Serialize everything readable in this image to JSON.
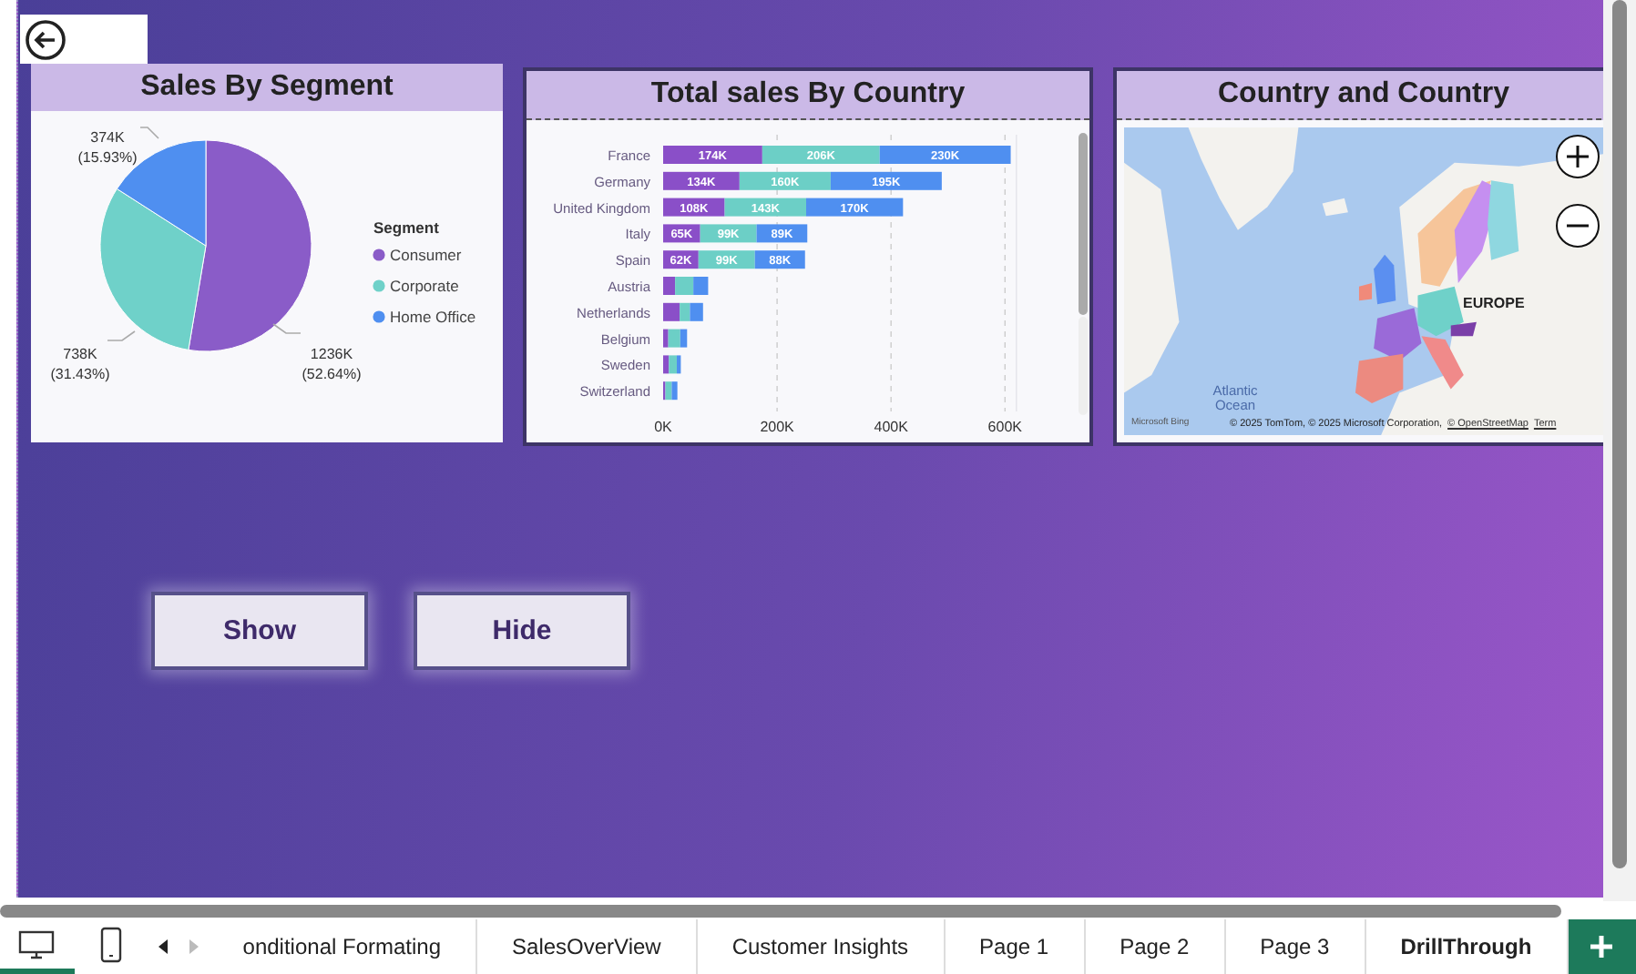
{
  "segment_card": {
    "title": "Sales By Segment",
    "chart_data": {
      "type": "pie",
      "legend": {
        "title": "Segment"
      },
      "categories": [
        "Consumer",
        "Corporate",
        "Home Office"
      ],
      "values": [
        52.64,
        31.43,
        15.93
      ],
      "colors": [
        "#8a5cc8",
        "#6fd1c9",
        "#4f8ff0"
      ],
      "value_labels": [
        "1236K (52.64%)",
        "738K (31.43%)",
        "374K (15.93%)"
      ]
    }
  },
  "country_card": {
    "title": "Total sales By Country",
    "chart_data": {
      "type": "bar",
      "orientation": "horizontal",
      "stacked": true,
      "categories": [
        "France",
        "Germany",
        "United Kingdom",
        "Italy",
        "Spain",
        "Austria",
        "Netherlands",
        "Belgium",
        "Sweden",
        "Switzerland"
      ],
      "series": [
        {
          "color": "#8a4fc8",
          "values": [
            174,
            134,
            108,
            65,
            62,
            21,
            29,
            9,
            10,
            4
          ],
          "value_labels": [
            "174K",
            "134K",
            "108K",
            "65K",
            "62K",
            null,
            null,
            null,
            null,
            null
          ]
        },
        {
          "color": "#6ccfc6",
          "values": [
            206,
            160,
            143,
            99,
            99,
            32,
            18,
            21,
            14,
            11
          ],
          "value_labels": [
            "206K",
            "160K",
            "143K",
            "99K",
            "99K",
            null,
            null,
            null,
            null,
            null
          ]
        },
        {
          "color": "#4f8ff0",
          "values": [
            230,
            195,
            170,
            89,
            88,
            26,
            23,
            12,
            7,
            10
          ],
          "value_labels": [
            "230K",
            "195K",
            "170K",
            "89K",
            "88K",
            null,
            null,
            null,
            null,
            null
          ]
        }
      ],
      "grid": true,
      "xlim": [
        0,
        620
      ],
      "xticks": [
        {
          "value": 0,
          "label": "0K"
        },
        {
          "value": 200,
          "label": "200K"
        },
        {
          "value": 400,
          "label": "400K"
        },
        {
          "value": 600,
          "label": "600K"
        }
      ]
    }
  },
  "map_card": {
    "title": "Country and Country",
    "region_label": "EUROPE",
    "ocean_label": "Atlantic Ocean",
    "brand": "Microsoft Bing",
    "attribution": "© 2025 TomTom, © 2025 Microsoft Corporation,",
    "attribution_link": "© OpenStreetMap",
    "terms_link": "Term"
  },
  "buttons": [
    {
      "label": "Show"
    },
    {
      "label": "Hide"
    }
  ],
  "views": [
    {
      "kind": "desktop",
      "selected": true
    },
    {
      "kind": "phone",
      "selected": false
    }
  ],
  "page_tabs": [
    {
      "label": "onditional Formating",
      "selected": false
    },
    {
      "label": "SalesOverView",
      "selected": false
    },
    {
      "label": "Customer Insights",
      "selected": false
    },
    {
      "label": "Page 1",
      "selected": false
    },
    {
      "label": "Page 2",
      "selected": false
    },
    {
      "label": "Page 3",
      "selected": false
    },
    {
      "label": "DrillThrough",
      "selected": true
    }
  ]
}
